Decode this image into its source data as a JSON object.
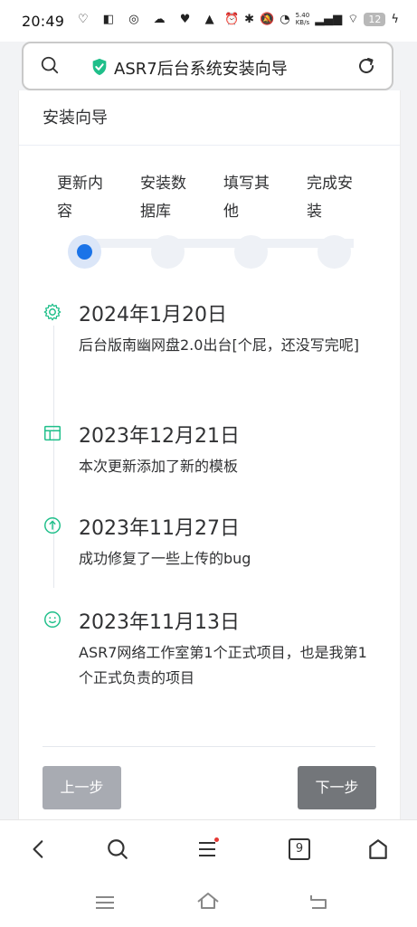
{
  "status_bar": {
    "time": "20:49",
    "left_icons": "♡ ◧ ◎ ☁ ♥ ▲",
    "net_speed_top": "5.40",
    "net_speed_bottom": "KB/s",
    "battery": "12"
  },
  "address_bar": {
    "title": "ASR7后台系统安装向导",
    "secure_color": "#1fbf8a"
  },
  "card": {
    "title": "安装向导"
  },
  "steps": [
    {
      "label": "更新内容",
      "active": true
    },
    {
      "label": "安装数据库",
      "active": false
    },
    {
      "label": "填写其他",
      "active": false
    },
    {
      "label": "完成安装",
      "active": false
    }
  ],
  "timeline": [
    {
      "icon": "gear-icon",
      "date": "2024年1月20日",
      "desc": "后台版南幽网盘2.0出台[个屁，还没写完呢]"
    },
    {
      "icon": "window-icon",
      "date": "2023年12月21日",
      "desc": "本次更新添加了新的模板"
    },
    {
      "icon": "arrow-up-circle-icon",
      "date": "2023年11月27日",
      "desc": "成功修复了一些上传的bug"
    },
    {
      "icon": "smile-icon",
      "date": "2023年11月13日",
      "desc": "ASR7网络工作室第1个正式项目，也是我第1个正式负责的项目"
    }
  ],
  "buttons": {
    "prev": "上一步",
    "next": "下一步"
  },
  "browser_nav": {
    "tab_count": "9"
  },
  "colors": {
    "accent": "#1a73e8",
    "timeline_icon": "#1fbf8a",
    "prev_button": "#a8abb2",
    "next_button": "#73767a"
  }
}
